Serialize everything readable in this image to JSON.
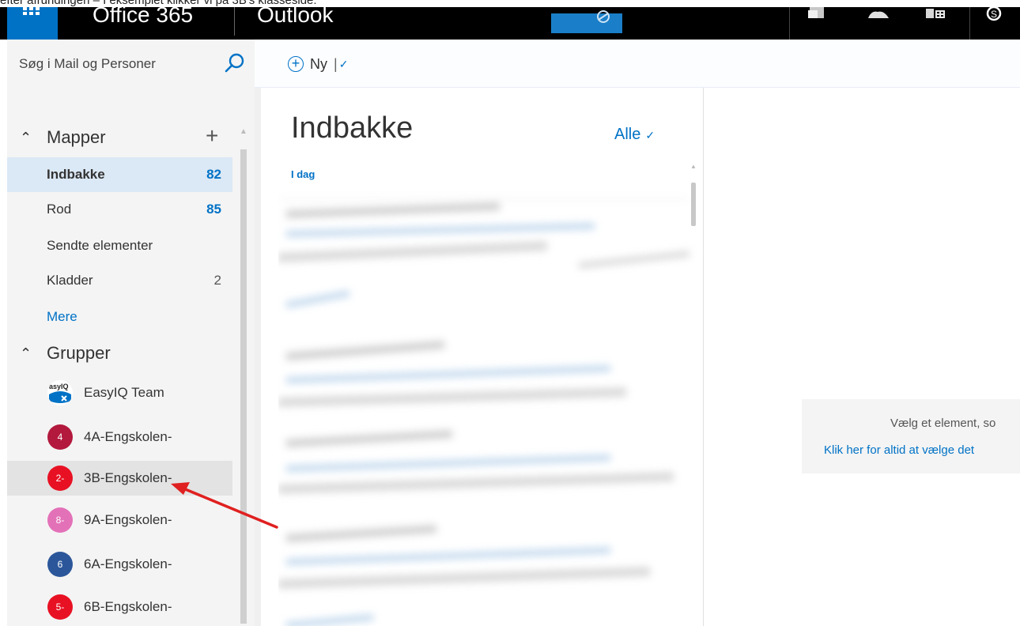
{
  "caption": "efter afrundingen – I eksemplet klikker vi på 3B's klasseside:",
  "topbar": {
    "office_label": "Office 365",
    "app_label": "Outlook"
  },
  "search": {
    "placeholder": "Søg i Mail og Personer",
    "icon": "search-icon"
  },
  "toolbar": {
    "new_label": "Ny",
    "new_icon": "plus-circle-icon"
  },
  "folders": {
    "section_title": "Mapper",
    "items": [
      {
        "label": "Indbakke",
        "count": "82",
        "selected": true
      },
      {
        "label": "Rod",
        "count": "85"
      },
      {
        "label": "Sendte elementer",
        "count": ""
      },
      {
        "label": "Kladder",
        "count": "2"
      }
    ],
    "more_label": "Mere"
  },
  "groups": {
    "section_title": "Grupper",
    "items": [
      {
        "label": "EasyIQ Team",
        "badge": "",
        "color": "#ffffff"
      },
      {
        "label": "4A-Engskolen-",
        "badge": "4",
        "color": "#b3193d"
      },
      {
        "label": "3B-Engskolen-",
        "badge": "2-",
        "color": "#e81123"
      },
      {
        "label": "9A-Engskolen-",
        "badge": "8-",
        "color": "#e371b8"
      },
      {
        "label": "6A-Engskolen-",
        "badge": "6",
        "color": "#2b579a"
      },
      {
        "label": "6B-Engskolen-",
        "badge": "5-",
        "color": "#e81123"
      }
    ]
  },
  "message_list": {
    "title": "Indbakke",
    "filter_label": "Alle",
    "day_label": "I dag"
  },
  "reading_pane": {
    "line1": "Vælg et element, so",
    "line2": "Klik her for altid at vælge det"
  },
  "colors": {
    "accent": "#0072c6",
    "annotation_arrow": "#e02020"
  }
}
